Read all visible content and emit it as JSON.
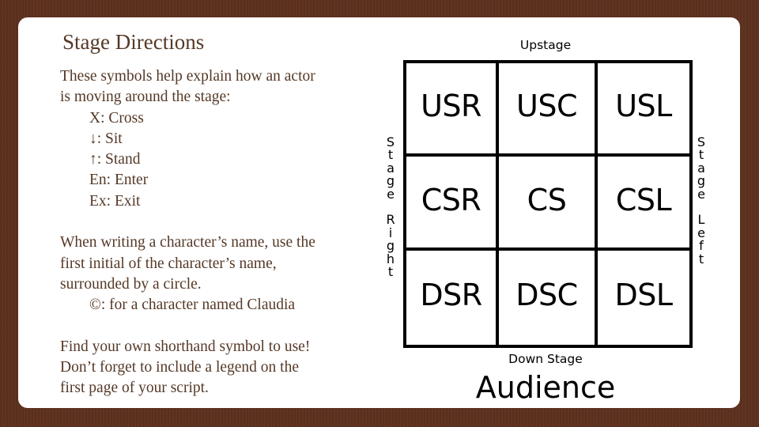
{
  "slide": {
    "title": "Stage Directions",
    "intro_lines": [
      "These symbols help explain how an actor",
      "is moving around the stage:"
    ],
    "symbols": [
      "X: Cross",
      "↓: Sit",
      "↑: Stand",
      "En: Enter",
      "Ex: Exit"
    ],
    "character_lines": [
      "When writing a character’s name, use the",
      "first initial of the character’s name,",
      "surrounded by a circle."
    ],
    "character_example": "©: for a character named Claudia",
    "closing_lines": [
      "Find your own shorthand symbol to use!",
      "Don’t forget to include a legend on the",
      "first page of your script."
    ]
  },
  "diagram": {
    "top_label": "Upstage",
    "bottom_label": "Down Stage",
    "audience_label": "Audience",
    "left_side_label": [
      "S",
      "t",
      "a",
      "g",
      "e",
      " ",
      "R",
      "i",
      "g",
      "h",
      "t"
    ],
    "right_side_label": [
      "S",
      "t",
      "a",
      "g",
      "e",
      " ",
      "L",
      "e",
      "f",
      "t"
    ],
    "cells": [
      [
        "USR",
        "USC",
        "USL"
      ],
      [
        "CSR",
        "CS",
        "CSL"
      ],
      [
        "DSR",
        "DSC",
        "DSL"
      ]
    ]
  },
  "colors": {
    "background": "#5d311e",
    "text": "#553927",
    "grid": "#000000"
  }
}
